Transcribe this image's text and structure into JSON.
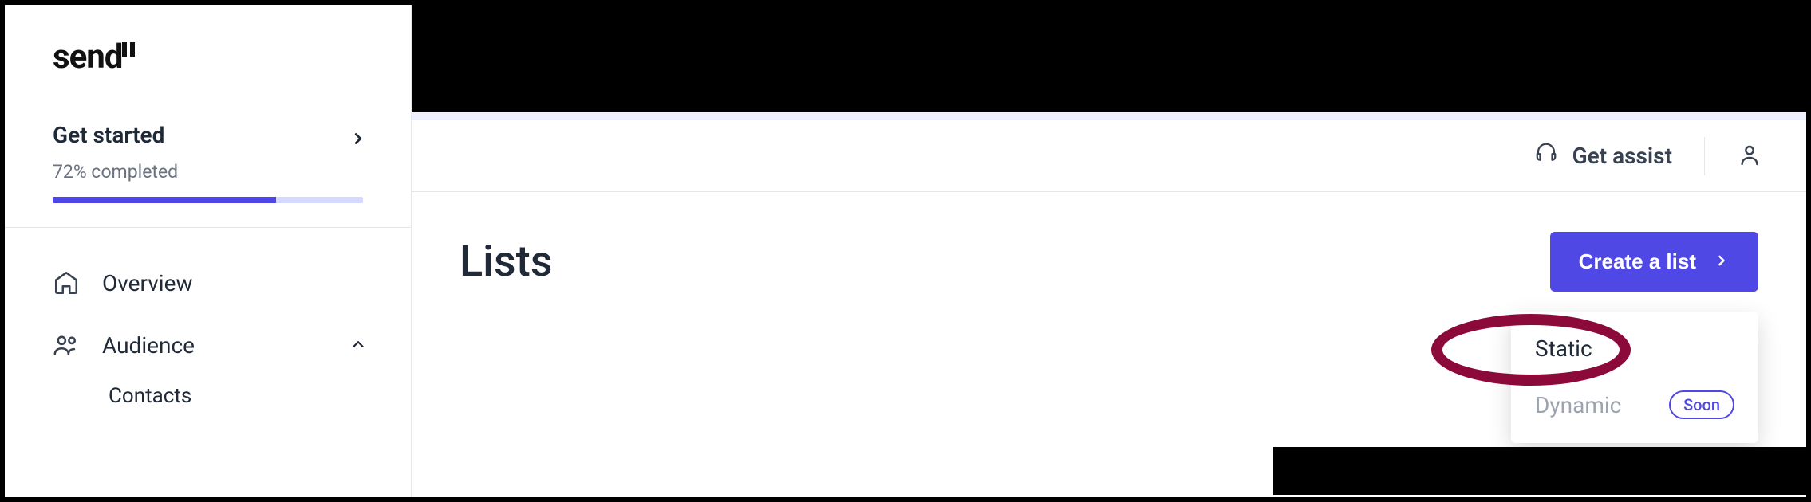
{
  "logo": "send",
  "get_started": {
    "title": "Get started",
    "progress_pct": 72,
    "sub": "72% completed"
  },
  "sidebar": {
    "items": [
      {
        "label": "Overview"
      },
      {
        "label": "Audience"
      },
      {
        "label": "Contacts"
      }
    ]
  },
  "topbar": {
    "assist_label": "Get assist"
  },
  "page": {
    "title": "Lists",
    "create_label": "Create a list"
  },
  "dropdown": {
    "static_label": "Static",
    "dynamic_label": "Dynamic",
    "soon_label": "Soon"
  }
}
